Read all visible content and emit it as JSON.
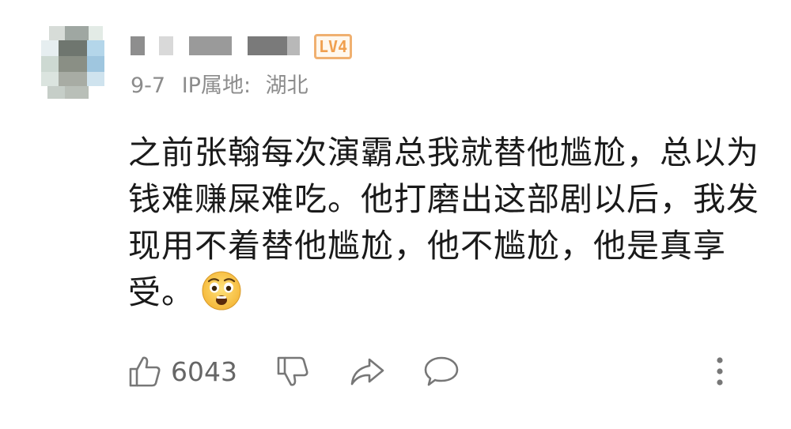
{
  "comment": {
    "author": {
      "name_masked": true,
      "level_badge": "LV4"
    },
    "date": "9-7",
    "ip_label": "IP属地:",
    "ip_location": "湖北",
    "text_lines": [
      "之前张翰每次演霸总我就替他尴尬，总以为",
      "钱难赚屎难吃。他打磨出这部剧以后，我发",
      "现用不着替他尴尬，他不尴尬，他是真享",
      "受。"
    ],
    "emoji": "anguished-face",
    "likes": "6043"
  },
  "actions": {
    "icons": [
      "thumbs-up-icon",
      "thumbs-down-icon",
      "share-icon",
      "comment-icon",
      "more-vertical-icon"
    ]
  },
  "colors": {
    "text": "#1a1a1a",
    "meta": "#8c8c8c",
    "badge": "#f0a050",
    "icon": "#777777"
  }
}
